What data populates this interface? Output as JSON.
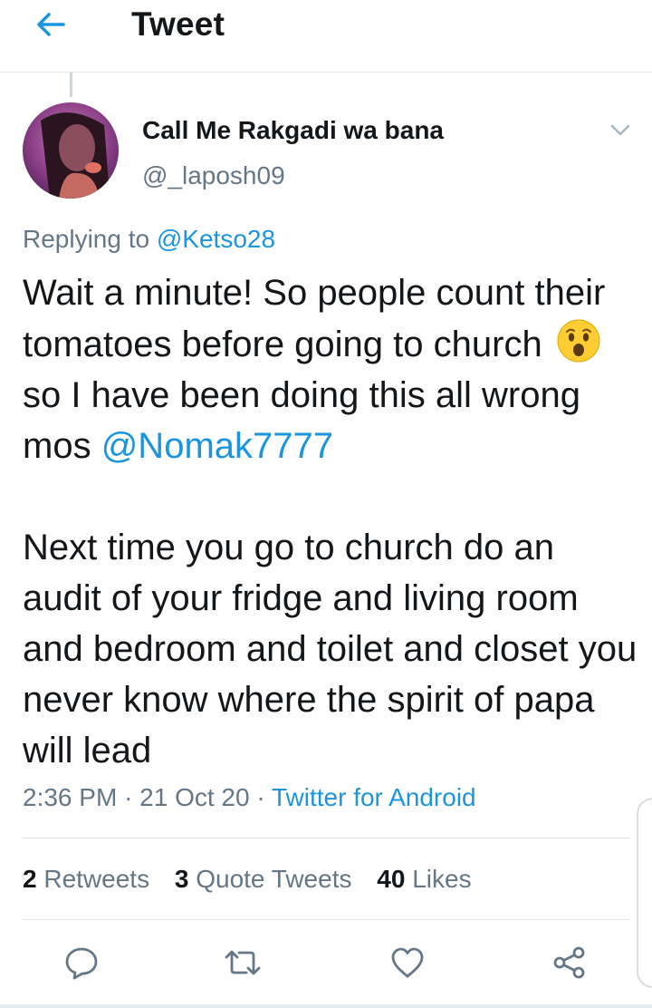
{
  "header": {
    "title": "Tweet"
  },
  "tweet": {
    "display_name": "Call Me Rakgadi wa bana",
    "handle": "@_laposh09",
    "replying_prefix": "Replying to",
    "replying_to": "@Ketso28",
    "text_part1": "Wait a minute! So people count their tomatoes before going to church",
    "emoji": "hushed-face-emoji",
    "text_part2": "so I have been doing this all wrong mos",
    "mention": "@Nomak7777",
    "text_para2": "Next time you go to church do an audit of your fridge and living room and bedroom and toilet and closet you never know where the spirit of papa will lead",
    "time": "2:36 PM",
    "sep": "·",
    "date": "21 Oct 20",
    "source": "Twitter for Android"
  },
  "stats": {
    "retweets_count": "2",
    "retweets_label": "Retweets",
    "quotes_count": "3",
    "quotes_label": "Quote Tweets",
    "likes_count": "40",
    "likes_label": "Likes"
  },
  "actions": [
    "reply-icon",
    "retweet-icon",
    "like-icon",
    "share-icon"
  ],
  "colors": {
    "accent": "#1b95e0",
    "muted": "#657786",
    "text": "#14171a"
  }
}
